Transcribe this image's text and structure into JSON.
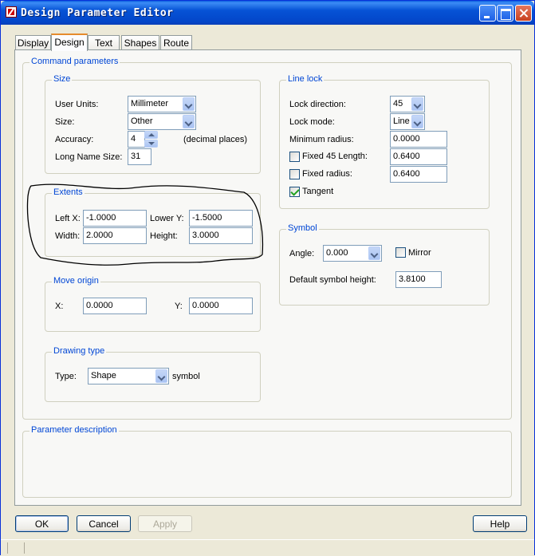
{
  "window": {
    "title": "Design Parameter Editor"
  },
  "tabs": [
    {
      "label": "Display"
    },
    {
      "label": "Design"
    },
    {
      "label": "Text"
    },
    {
      "label": "Shapes"
    },
    {
      "label": "Route"
    }
  ],
  "active_tab": "Design",
  "command_parameters": {
    "label": "Command parameters",
    "size_group": {
      "label": "Size",
      "user_units_label": "User Units:",
      "user_units_value": "Millimeter",
      "size_label": "Size:",
      "size_value": "Other",
      "accuracy_label": "Accuracy:",
      "accuracy_value": "4",
      "accuracy_suffix": "(decimal places)",
      "long_name_label": "Long Name Size:",
      "long_name_value": "31"
    },
    "extents_group": {
      "label": "Extents",
      "left_x_label": "Left X:",
      "left_x_value": "-1.0000",
      "lower_y_label": "Lower Y:",
      "lower_y_value": "-1.5000",
      "width_label": "Width:",
      "width_value": "2.0000",
      "height_label": "Height:",
      "height_value": "3.0000"
    },
    "move_origin_group": {
      "label": "Move origin",
      "x_label": "X:",
      "x_value": "0.0000",
      "y_label": "Y:",
      "y_value": "0.0000"
    },
    "drawing_type_group": {
      "label": "Drawing type",
      "type_label": "Type:",
      "type_value": "Shape",
      "type_suffix": "symbol"
    },
    "line_lock_group": {
      "label": "Line lock",
      "lock_direction_label": "Lock direction:",
      "lock_direction_value": "45",
      "lock_mode_label": "Lock mode:",
      "lock_mode_value": "Line",
      "min_radius_label": "Minimum radius:",
      "min_radius_value": "0.0000",
      "fixed45_label": "Fixed 45 Length:",
      "fixed45_value": "0.6400",
      "fixed45_checked": false,
      "fixed_radius_label": "Fixed radius:",
      "fixed_radius_value": "0.6400",
      "fixed_radius_checked": false,
      "tangent_label": "Tangent",
      "tangent_checked": true
    },
    "symbol_group": {
      "label": "Symbol",
      "angle_label": "Angle:",
      "angle_value": "0.000",
      "mirror_label": "Mirror",
      "mirror_checked": false,
      "default_height_label": "Default symbol height:",
      "default_height_value": "3.8100"
    }
  },
  "parameter_description": {
    "label": "Parameter description"
  },
  "buttons": {
    "ok": "OK",
    "cancel": "Cancel",
    "apply": "Apply",
    "help": "Help"
  }
}
